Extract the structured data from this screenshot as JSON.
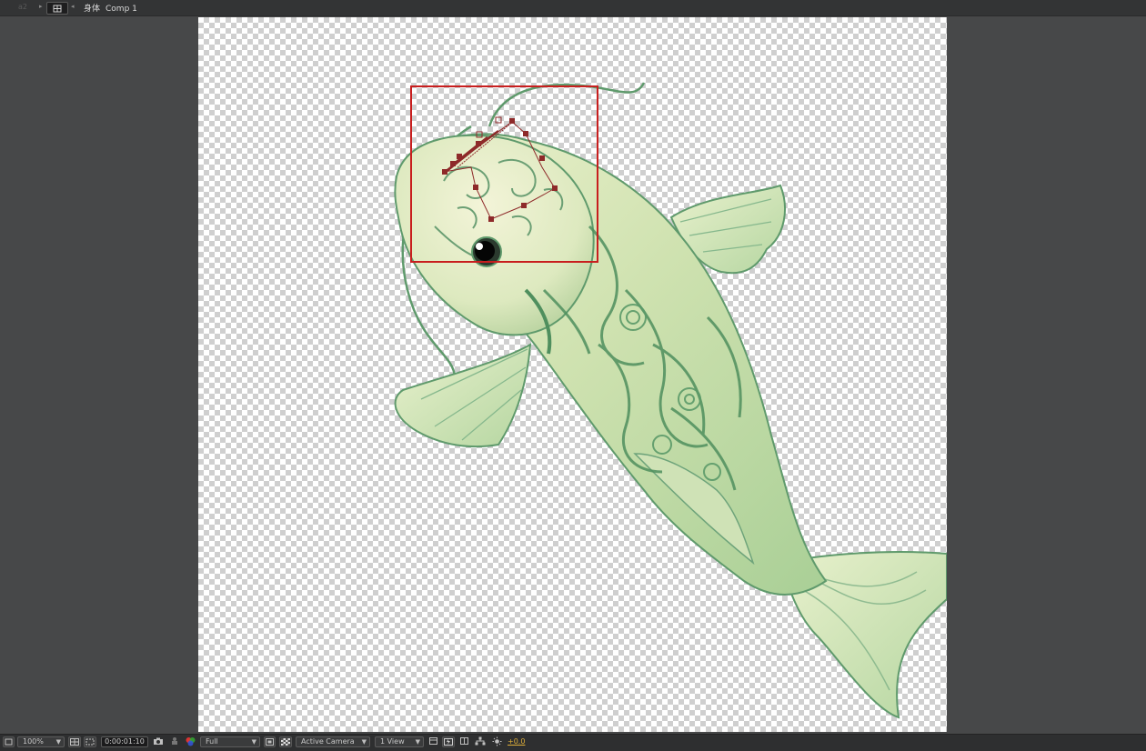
{
  "topbar": {
    "ghost_tab": "a2",
    "comp_name_zh": "身体",
    "comp_name": "Comp 1",
    "lock_icon": "comp-lock-icon"
  },
  "bottombar": {
    "zoom": "100%",
    "timecode": "0:00:01:10",
    "resolution": "Full",
    "camera": "Active Camera",
    "views": "1 View",
    "exposure": "+0.0"
  },
  "canvas": {
    "content": "koi-fish-layer",
    "selection_box_color": "#c81e1e",
    "mask_path_color": "#8e2a2a"
  },
  "colors": {
    "panel_bg": "#474849",
    "toolbar_bg": "#2e2f30",
    "accent_exposure": "#e0b03a"
  }
}
